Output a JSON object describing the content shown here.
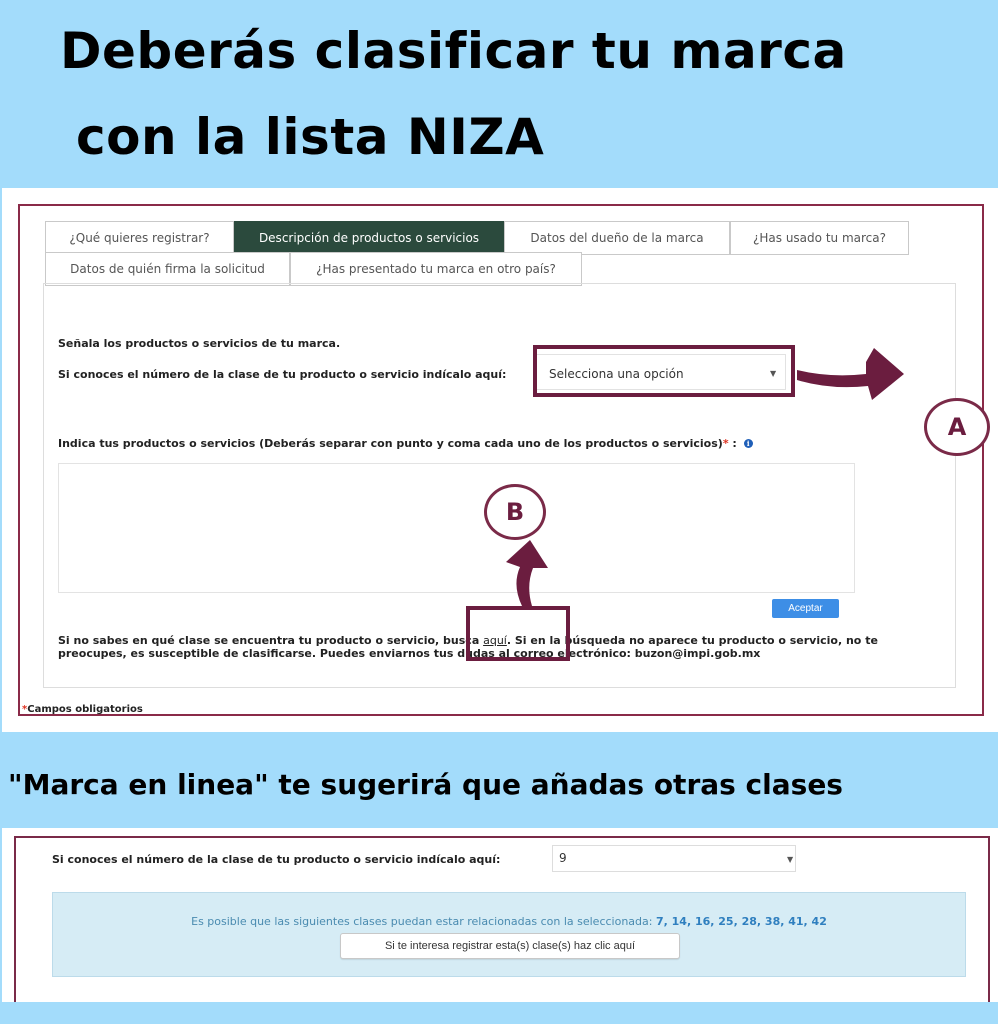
{
  "headlines": {
    "line1": "Deberás clasificar tu marca",
    "line2": "con la lista NIZA",
    "line3": "\"Marca en linea\" te sugerirá  que añadas otras clases"
  },
  "tabs": [
    {
      "label": "¿Qué quieres registrar?",
      "active": false
    },
    {
      "label": "Descripción de productos o servicios",
      "active": true
    },
    {
      "label": "Datos del dueño de la marca",
      "active": false
    },
    {
      "label": "¿Has usado tu marca?",
      "active": false
    },
    {
      "label": "Datos de quién firma la solicitud",
      "active": false
    },
    {
      "label": "¿Has presentado tu marca en otro país?",
      "active": false
    }
  ],
  "form": {
    "section_title": "Señala los productos o servicios de tu marca.",
    "class_label": "Si conoces el número de la clase de tu producto o servicio indícalo aquí:",
    "class_select_value": "Selecciona una opción",
    "products_label": "Indica tus productos o servicios (Deberás separar con punto y coma cada uno de los productos o servicios)",
    "required_marker": "*",
    "products_colon": " :",
    "info_icon_glyph": "i",
    "products_value": "",
    "accept_label": "Aceptar",
    "help_part1": "Si no sabes en qué clase se encuentra tu producto o servicio, busca ",
    "help_link": "aquí",
    "help_part2": ". Si en la búsqueda no aparece tu producto o servicio, no te preocupes, es susceptible de clasificarse. Puedes enviarnos tus dudas al correo electrónico: buzon@impi.gob.mx",
    "required_fields": "Campos obligatorios"
  },
  "annotations": {
    "badge_a": "A",
    "badge_b": "B",
    "color": "#6b1d3f"
  },
  "suggestion": {
    "class_label": "Si conoces el número de la clase de tu producto o servicio indícalo aquí:",
    "class_select_value": "9",
    "related_text": "Es posible que las siguientes clases puedan estar relacionadas con la seleccionada:",
    "related_classes": "7, 14, 16, 25, 28, 38, 41, 42",
    "register_button": "Si te interesa registrar esta(s) clase(s) haz clic aquí"
  },
  "colors": {
    "background": "#a3dcfb",
    "active_tab": "#2b4a3d",
    "frame": "#8a2a48",
    "accept_button": "#3d8ee6",
    "suggestion_box": "#d6ecf5"
  }
}
